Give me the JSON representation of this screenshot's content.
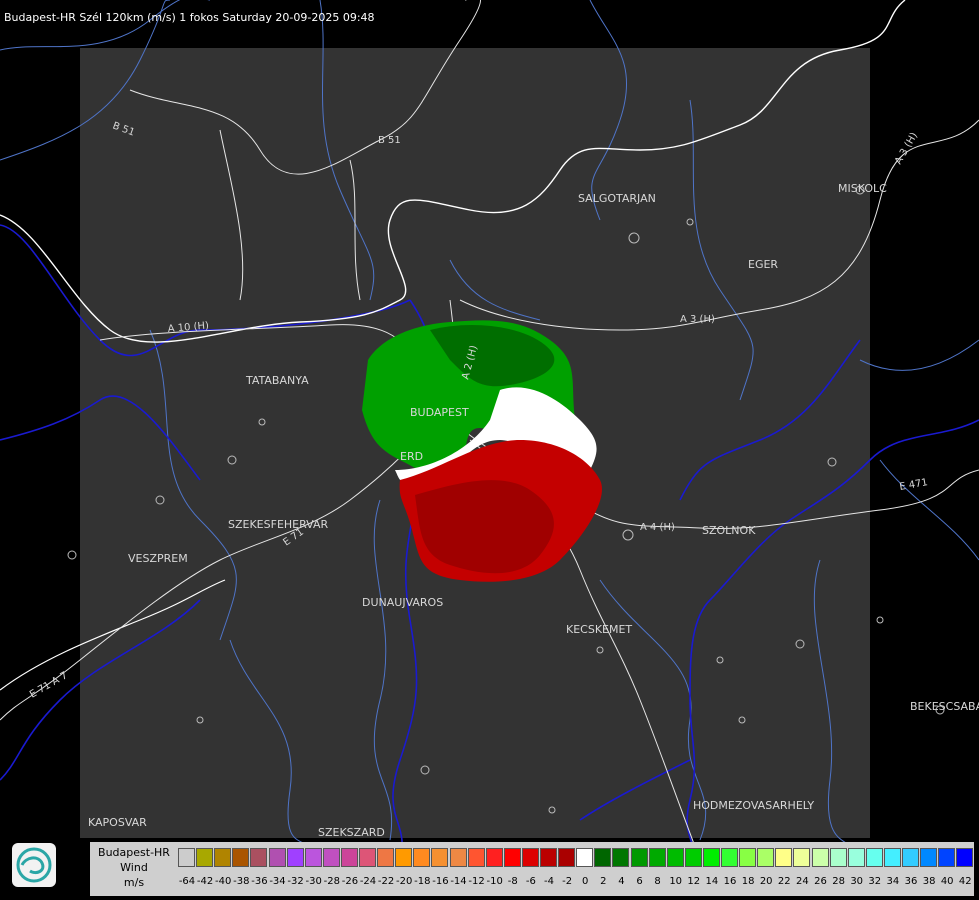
{
  "header": {
    "title": "Budapest-HR Szél 120km (m/s) 1 fokos Saturday 20-09-2025 09:48"
  },
  "map": {
    "cities": [
      {
        "id": "salgotarjan",
        "name": "SALGOTARJAN"
      },
      {
        "id": "miskolc",
        "name": "MISKOLC"
      },
      {
        "id": "eger",
        "name": "EGER"
      },
      {
        "id": "tatabanya",
        "name": "TATABANYA"
      },
      {
        "id": "budapest",
        "name": "BUDAPEST"
      },
      {
        "id": "erd",
        "name": "ERD"
      },
      {
        "id": "szekesfehervar",
        "name": "SZEKESFEHERVAR"
      },
      {
        "id": "veszprem",
        "name": "VESZPREM"
      },
      {
        "id": "dunaujvaros",
        "name": "DUNAUJVAROS"
      },
      {
        "id": "kecskemet",
        "name": "KECSKEMET"
      },
      {
        "id": "szolnok",
        "name": "SZOLNOK"
      },
      {
        "id": "bekescsaba",
        "name": "BEKESCSABA"
      },
      {
        "id": "hodmezovasarhely",
        "name": "HODMEZOVASARHELY"
      },
      {
        "id": "kaposvar",
        "name": "KAPOSVAR"
      },
      {
        "id": "szekszard",
        "name": "SZEKSZARD"
      }
    ],
    "roads": [
      {
        "id": "b51-west",
        "name": "B 51"
      },
      {
        "id": "b51-east",
        "name": "B 51"
      },
      {
        "id": "a3-north",
        "name": "A 3 (H)"
      },
      {
        "id": "a3-east",
        "name": "A 3 (H)"
      },
      {
        "id": "a4",
        "name": "A 4 (H)"
      },
      {
        "id": "e471",
        "name": "E 471"
      },
      {
        "id": "a10",
        "name": "A 10 (H)"
      },
      {
        "id": "m0",
        "name": "A 2 (H)"
      },
      {
        "id": "e71",
        "name": "E 71"
      },
      {
        "id": "e71-sw",
        "name": "E 71 A 7"
      }
    ],
    "colors": {
      "frame": "#333333",
      "border_line": "#ffffff",
      "river": "#1a1ad0",
      "minor_water": "#4f74c8",
      "label": "#d8d8d8"
    }
  },
  "legend": {
    "station": "Budapest-HR",
    "quantity": "Wind",
    "unit": "m/s",
    "ticks": [
      "-64",
      "-42",
      "-40",
      "-38",
      "-36",
      "-34",
      "-32",
      "-30",
      "-28",
      "-26",
      "-24",
      "-22",
      "-20",
      "-18",
      "-16",
      "-14",
      "-12",
      "-10",
      "-8",
      "-6",
      "-4",
      "-2",
      "0",
      "2",
      "4",
      "6",
      "8",
      "10",
      "12",
      "14",
      "16",
      "18",
      "20",
      "22",
      "24",
      "26",
      "28",
      "30",
      "32",
      "34",
      "36",
      "38",
      "40",
      "42"
    ],
    "colors": [
      "#cccccc",
      "#a8a800",
      "#b08400",
      "#aa5500",
      "#aa5060",
      "#b050b0",
      "#a040ff",
      "#bb55dd",
      "#c050c0",
      "#cc4499",
      "#dd5577",
      "#ee7744",
      "#ff9a00",
      "#ff8a20",
      "#f59030",
      "#ee8844",
      "#ff5530",
      "#ff2020",
      "#ff0000",
      "#dd0000",
      "#bb0000",
      "#aa0000",
      "#ffffff",
      "#006600",
      "#007700",
      "#009900",
      "#00aa00",
      "#00bb00",
      "#00cc00",
      "#00ee00",
      "#33ff33",
      "#88ff44",
      "#aaff66",
      "#ffff88",
      "#eeff99",
      "#ccffaa",
      "#aaffcc",
      "#99ffdd",
      "#66ffee",
      "#44eeff",
      "#33ccff",
      "#0088ff",
      "#0044ff",
      "#0000ff"
    ]
  }
}
